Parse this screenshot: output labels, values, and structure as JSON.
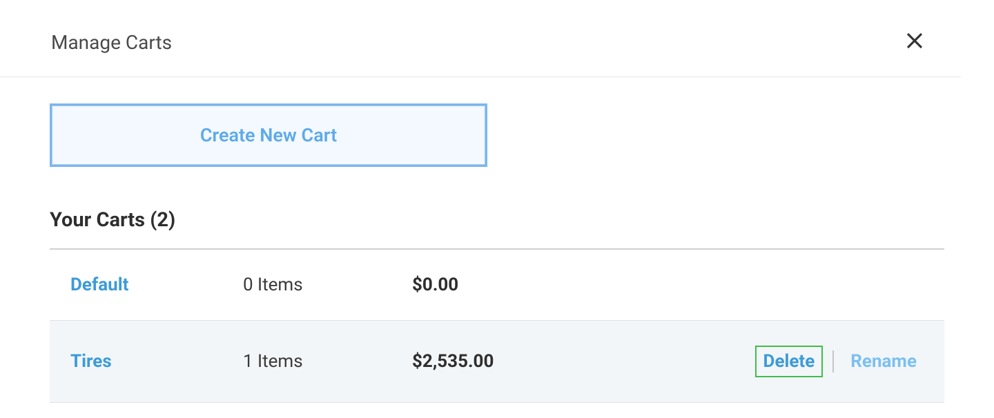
{
  "dialog": {
    "title": "Manage Carts"
  },
  "create_button": {
    "label": "Create New Cart"
  },
  "subheading": "Your Carts (2)",
  "carts": [
    {
      "name": "Default",
      "items": "0 Items",
      "price": "$0.00",
      "highlighted": false,
      "show_actions": false
    },
    {
      "name": "Tires",
      "items": "1 Items",
      "price": "$2,535.00",
      "highlighted": true,
      "show_actions": true
    }
  ],
  "actions": {
    "delete": "Delete",
    "rename": "Rename"
  }
}
